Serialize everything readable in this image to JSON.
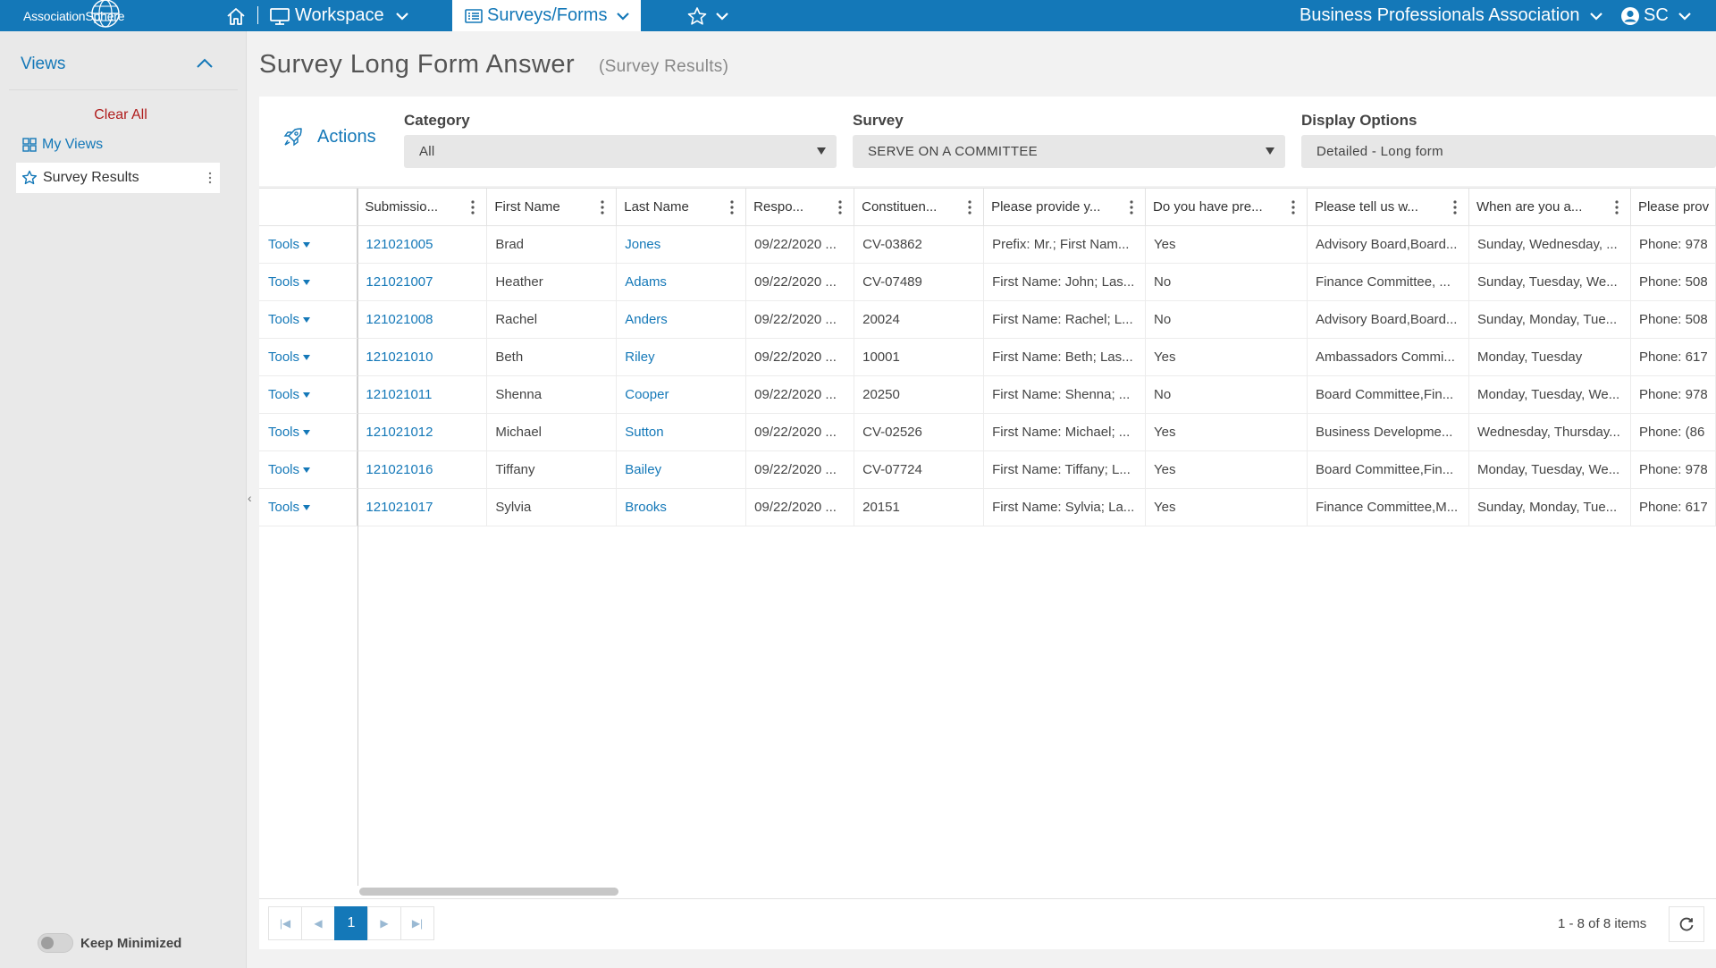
{
  "app": {
    "logo_text": "AssociationSphere"
  },
  "topnav": {
    "workspace_label": "Workspace",
    "surveys_label": "Surveys/Forms",
    "org_label": "Business Professionals Association",
    "user_label": "SC",
    "accent": "#1478b8"
  },
  "sidebar": {
    "views_label": "Views",
    "clear_all_label": "Clear All",
    "my_views_label": "My Views",
    "survey_results_label": "Survey Results",
    "keep_minimized_label": "Keep Minimized"
  },
  "page": {
    "title": "Survey Long Form Answer",
    "subtitle": "(Survey Results)"
  },
  "filters": {
    "actions_label": "Actions",
    "category_label": "Category",
    "category_value": "All",
    "survey_label": "Survey",
    "survey_value": "SERVE ON A COMMITTEE",
    "display_label": "Display Options",
    "display_value": "Detailed - Long form"
  },
  "grid": {
    "columns": [
      "Submissio...",
      "First Name",
      "Last Name",
      "Respo...",
      "Constituen...",
      "Please provide y...",
      "Do you have pre...",
      "Please tell us w...",
      "When are you a...",
      "Please prov"
    ],
    "tools_label": "Tools",
    "rows": [
      {
        "submission": "121021005",
        "first": "Brad",
        "last": "Jones",
        "resp": "09/22/2020 ...",
        "const": "CV-03862",
        "provide": "Prefix: Mr.; First Nam...",
        "prev": "Yes",
        "tell": "Advisory Board,Board...",
        "when": "Sunday, Wednesday, ...",
        "phone": "Phone: 978"
      },
      {
        "submission": "121021007",
        "first": "Heather",
        "last": "Adams",
        "resp": "09/22/2020 ...",
        "const": "CV-07489",
        "provide": "First Name: John; Las...",
        "prev": "No",
        "tell": "Finance Committee, ...",
        "when": "Sunday, Tuesday, We...",
        "phone": "Phone: 508"
      },
      {
        "submission": "121021008",
        "first": "Rachel",
        "last": "Anders",
        "resp": "09/22/2020 ...",
        "const": "20024",
        "provide": "First Name: Rachel; L...",
        "prev": "No",
        "tell": "Advisory Board,Board...",
        "when": "Sunday, Monday, Tue...",
        "phone": "Phone: 508"
      },
      {
        "submission": "121021010",
        "first": "Beth",
        "last": "Riley",
        "resp": "09/22/2020 ...",
        "const": "10001",
        "provide": "First Name: Beth; Las...",
        "prev": "Yes",
        "tell": "Ambassadors Commi...",
        "when": "Monday, Tuesday",
        "phone": "Phone: 617"
      },
      {
        "submission": "121021011",
        "first": "Shenna",
        "last": "Cooper",
        "resp": "09/22/2020 ...",
        "const": "20250",
        "provide": "First Name: Shenna; ...",
        "prev": "No",
        "tell": "Board Committee,Fin...",
        "when": "Monday, Tuesday, We...",
        "phone": "Phone: 978"
      },
      {
        "submission": "121021012",
        "first": "Michael",
        "last": "Sutton",
        "resp": "09/22/2020 ...",
        "const": "CV-02526",
        "provide": "First Name: Michael; ...",
        "prev": "Yes",
        "tell": " Business Developme...",
        "when": "Wednesday, Thursday...",
        "phone": "Phone: (86"
      },
      {
        "submission": "121021016",
        "first": "Tiffany",
        "last": "Bailey",
        "resp": "09/22/2020 ...",
        "const": "CV-07724",
        "provide": "First Name: Tiffany; L...",
        "prev": "Yes",
        "tell": "Board Committee,Fin...",
        "when": "Monday, Tuesday, We...",
        "phone": "Phone: 978"
      },
      {
        "submission": "121021017",
        "first": "Sylvia",
        "last": "Brooks",
        "resp": "09/22/2020 ...",
        "const": "20151",
        "provide": "First Name: Sylvia; La...",
        "prev": "Yes",
        "tell": "Finance Committee,M...",
        "when": "Sunday, Monday, Tue...",
        "phone": "Phone: 617"
      }
    ]
  },
  "pager": {
    "current_page": "1",
    "info": "1 - 8 of 8 items"
  }
}
